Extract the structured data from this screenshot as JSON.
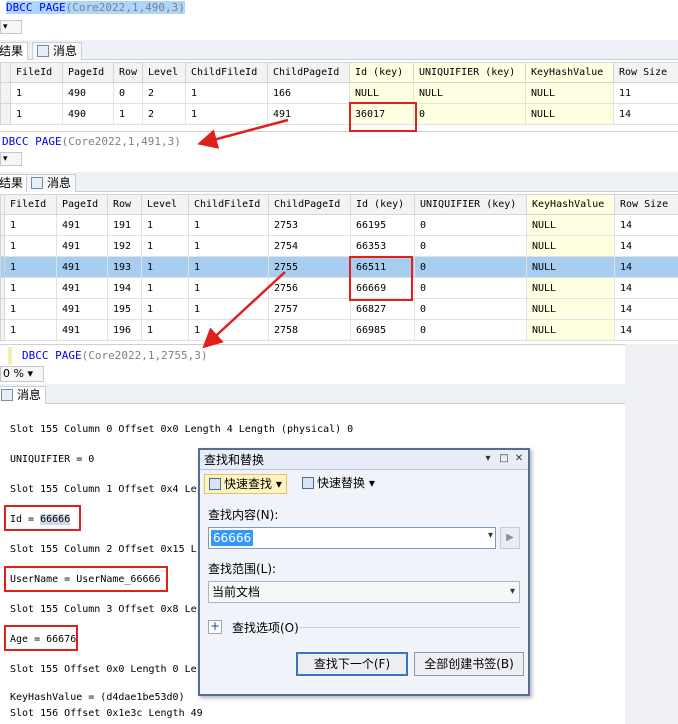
{
  "query1": {
    "code_keyword": "DBCC PAGE",
    "code_args": "(Core2022,1,490,3)"
  },
  "tabs1": {
    "results": "结果",
    "messages": "消息"
  },
  "grid1": {
    "columns": [
      "FileId",
      "PageId",
      "Row",
      "Level",
      "ChildFileId",
      "ChildPageId",
      "Id (key)",
      "UNIQUIFIER (key)",
      "KeyHashValue",
      "Row Size"
    ],
    "rows": [
      [
        "1",
        "490",
        "0",
        "2",
        "1",
        "166",
        "NULL",
        "NULL",
        "NULL",
        "11"
      ],
      [
        "1",
        "490",
        "1",
        "2",
        "1",
        "491",
        "36017",
        "0",
        "NULL",
        "14"
      ]
    ]
  },
  "query2": {
    "code_keyword": "DBCC PAGE",
    "code_args": "(Core2022,1,491,3)"
  },
  "tabs2": {
    "results": "结果",
    "messages": "消息"
  },
  "grid2": {
    "columns": [
      "FileId",
      "PageId",
      "Row",
      "Level",
      "ChildFileId",
      "ChildPageId",
      "Id (key)",
      "UNIQUIFIER (key)",
      "KeyHashValue",
      "Row Size"
    ],
    "rows": [
      [
        "1",
        "491",
        "191",
        "1",
        "1",
        "2753",
        "66195",
        "0",
        "NULL",
        "14"
      ],
      [
        "1",
        "491",
        "192",
        "1",
        "1",
        "2754",
        "66353",
        "0",
        "NULL",
        "14"
      ],
      [
        "1",
        "491",
        "193",
        "1",
        "1",
        "2755",
        "66511",
        "0",
        "NULL",
        "14"
      ],
      [
        "1",
        "491",
        "194",
        "1",
        "1",
        "2756",
        "66669",
        "0",
        "NULL",
        "14"
      ],
      [
        "1",
        "491",
        "195",
        "1",
        "1",
        "2757",
        "66827",
        "0",
        "NULL",
        "14"
      ],
      [
        "1",
        "491",
        "196",
        "1",
        "1",
        "2758",
        "66985",
        "0",
        "NULL",
        "14"
      ]
    ]
  },
  "query3": {
    "code_keyword": "DBCC PAGE",
    "code_args": "(Core2022,1,2755,3)"
  },
  "zoom": {
    "value": "0 %"
  },
  "tabs3": {
    "messages": "消息"
  },
  "output": {
    "lines": [
      "Slot 155 Column 0 Offset 0x0 Length 4 Length (physical) 0",
      "UNIQUIFIER = 0",
      "Slot 155 Column 1 Offset 0x4 Le",
      "Slot 155 Column 2 Offset 0x15 L",
      "Slot 155 Column 3 Offset 0x8 Le",
      "Slot 155 Offset 0x0 Length 0 Le",
      "KeyHashValue = (d4dae1be53d0)",
      "Slot 156 Offset 0x1e3c Length 49"
    ],
    "id_label": "Id = ",
    "id_value": "66666",
    "username_label": "UserName = ",
    "username_value": "UserName_66666",
    "age_line": "Age = 66676"
  },
  "find_dialog": {
    "title": "查找和替换",
    "ctrl_pin": "▾",
    "ctrl_max": "□",
    "ctrl_close": "✕",
    "quick_find": "快速查找",
    "quick_replace": "快速替换",
    "find_label": "查找内容(N):",
    "find_value": "66666",
    "scope_label": "查找范围(L):",
    "scope_value": "当前文档",
    "options_label": "查找选项(O)",
    "find_next": "查找下一个(F)",
    "bookmark_all": "全部创建书签(B)"
  }
}
